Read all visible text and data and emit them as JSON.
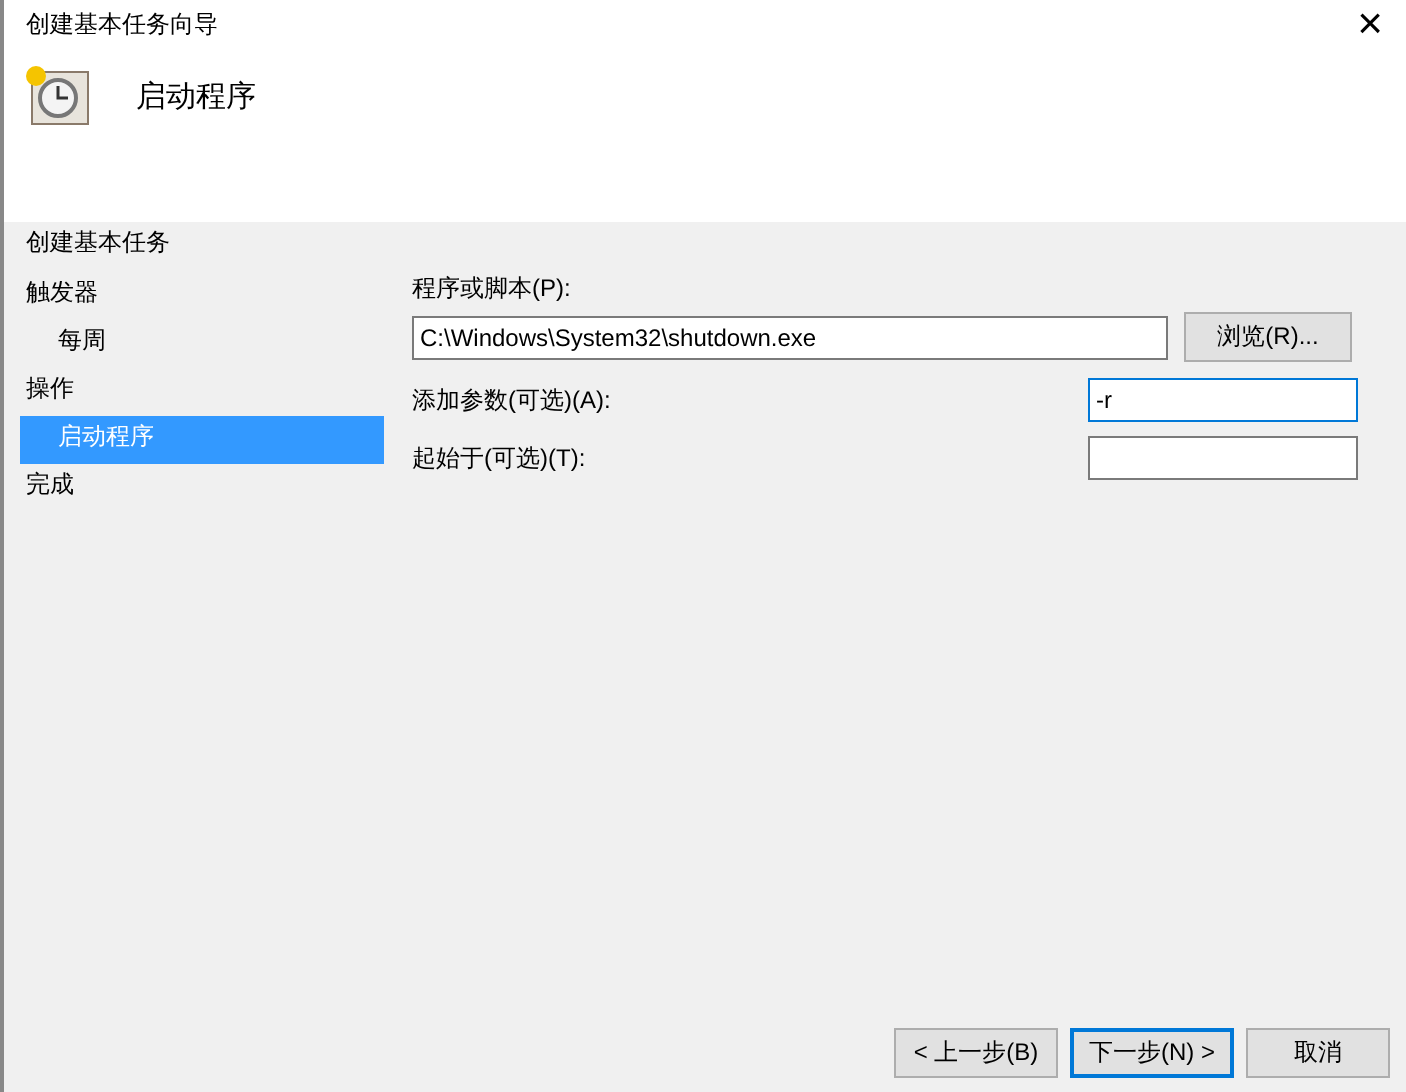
{
  "window": {
    "title": "创建基本任务向导",
    "close": "×"
  },
  "header": {
    "title": "启动程序"
  },
  "sidebar": {
    "title": "创建基本任务",
    "items": [
      {
        "label": "触发器",
        "selected": false,
        "children": [
          {
            "label": "每周",
            "selected": false
          }
        ]
      },
      {
        "label": "操作",
        "selected": false,
        "children": [
          {
            "label": "启动程序",
            "selected": true
          }
        ]
      },
      {
        "label": "完成",
        "selected": false
      }
    ]
  },
  "form": {
    "program": {
      "label": "程序或脚本(P):",
      "value": "C:\\Windows\\System32\\shutdown.exe",
      "browse": "浏览(R)..."
    },
    "fields": [
      {
        "label": "添加参数(可选)(A):",
        "value": "-r",
        "focused": true
      },
      {
        "label": "起始于(可选)(T):",
        "focused": false
      }
    ]
  },
  "buttons": [
    {
      "label": "< 上一步(B)",
      "default": false
    },
    {
      "label": "下一步(N) >",
      "default": true
    },
    {
      "label": "取消",
      "default": false
    }
  ]
}
